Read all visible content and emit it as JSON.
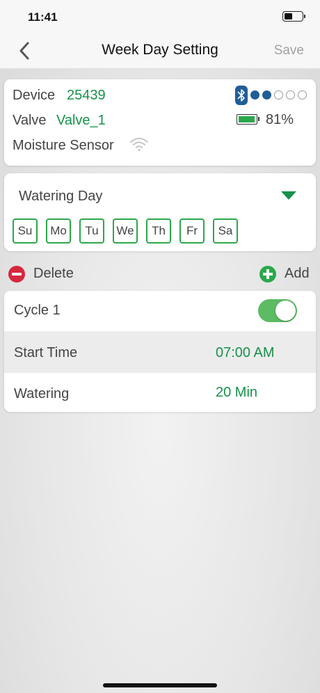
{
  "status": {
    "time": "11:41"
  },
  "nav": {
    "title": "Week Day Setting",
    "save_label": "Save"
  },
  "device": {
    "device_label": "Device",
    "device_value": "25439",
    "valve_label": "Valve",
    "valve_value": "Valve_1",
    "sensor_label": "Moisture Sensor",
    "battery_pct": "81%",
    "signal_level": 2,
    "signal_total": 5
  },
  "watering_day": {
    "label": "Watering Day",
    "days": [
      "Su",
      "Mo",
      "Tu",
      "We",
      "Th",
      "Fr",
      "Sa"
    ]
  },
  "actions": {
    "delete_label": "Delete",
    "add_label": "Add"
  },
  "cycle": {
    "name": "Cycle 1",
    "enabled": true,
    "start_time_label": "Start Time",
    "start_time_value": "07:00 AM",
    "watering_label": "Watering",
    "watering_value": "20 Min"
  },
  "colors": {
    "accent_green": "#15924a",
    "toggle_green": "#5dbb63",
    "delete_red": "#d6273d",
    "bluetooth_blue": "#1f5e96"
  }
}
